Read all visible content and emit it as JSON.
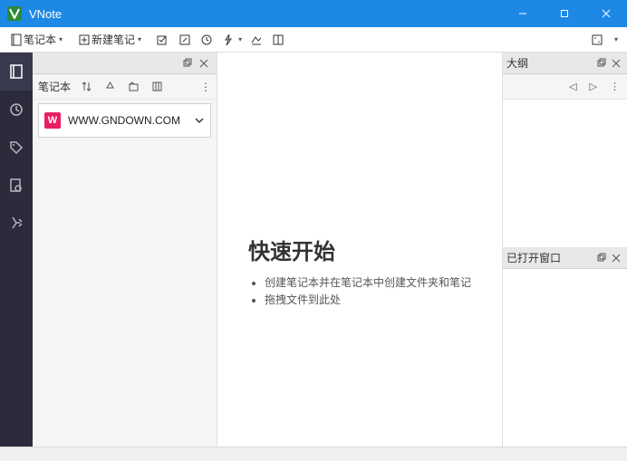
{
  "app": {
    "title": "VNote"
  },
  "toolbar": {
    "notebook_label": "笔记本",
    "new_note_label": "新建笔记"
  },
  "sidepanel": {
    "tab_label": "笔记本",
    "notebook": {
      "badge": "W",
      "name": "WWW.GNDOWN.COM"
    }
  },
  "content": {
    "heading": "快速开始",
    "bullets": [
      "创建笔记本并在笔记本中创建文件夹和笔记",
      "拖拽文件到此处"
    ]
  },
  "right": {
    "outline_title": "大纲",
    "opened_title": "已打开窗口"
  }
}
